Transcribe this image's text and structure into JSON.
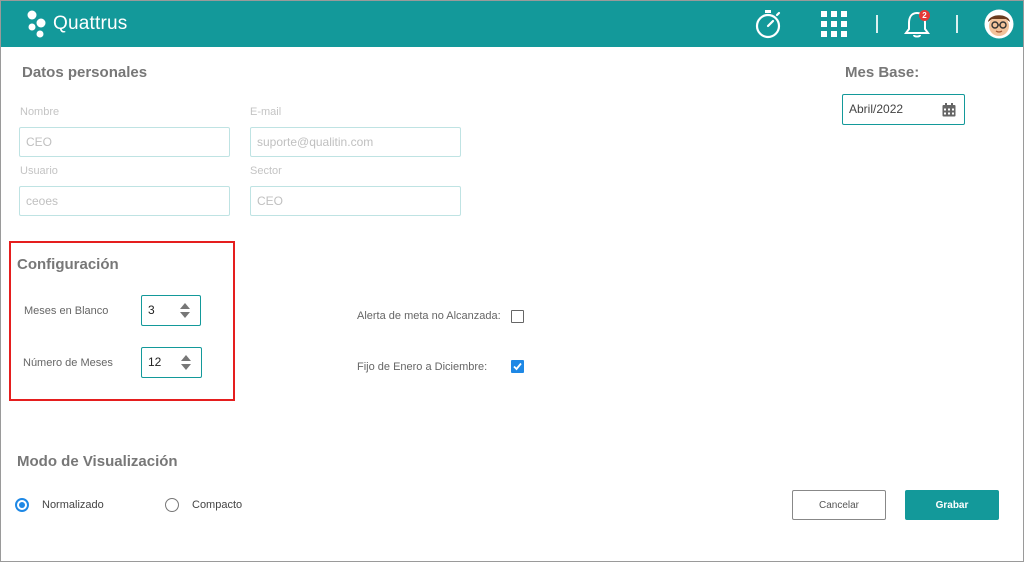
{
  "header": {
    "app_name": "Quattrus",
    "notification_count": "2",
    "colors": {
      "bar": "#13999a"
    }
  },
  "personal": {
    "title": "Datos personales",
    "nombre_label": "Nombre",
    "nombre_value": "CEO",
    "email_label": "E-mail",
    "email_value": "suporte@qualitin.com",
    "usuario_label": "Usuario",
    "usuario_value": "ceoes",
    "sector_label": "Sector",
    "sector_value": "CEO"
  },
  "mes_base": {
    "title": "Mes Base:",
    "value": "Abril/2022"
  },
  "config": {
    "title": "Configuración",
    "meses_blanco_label": "Meses en Blanco",
    "meses_blanco_value": "3",
    "numero_meses_label": "Número de Meses",
    "numero_meses_value": "12",
    "alerta_label": "Alerta de meta no Alcanzada:",
    "alerta_checked": false,
    "fijo_label": "Fijo de Enero a Diciembre:",
    "fijo_checked": true
  },
  "visualizacion": {
    "title": "Modo de Visualización",
    "options": [
      {
        "label": "Normalizado",
        "selected": true
      },
      {
        "label": "Compacto",
        "selected": false
      }
    ]
  },
  "actions": {
    "cancel_label": "Cancelar",
    "save_label": "Grabar"
  }
}
